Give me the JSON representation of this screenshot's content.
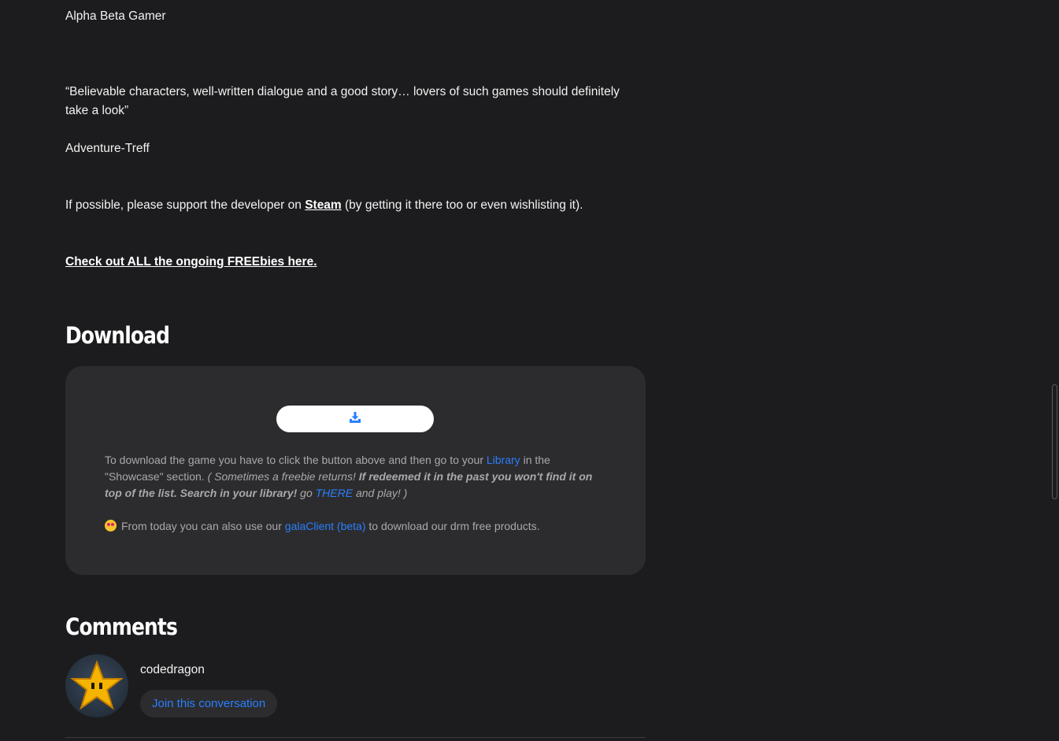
{
  "reviews": {
    "source_1": "Alpha Beta Gamer",
    "quote_2": "“Believable characters, well-written dialogue and a good story… lovers of such games should definitely take a look”",
    "source_2": "Adventure-Treff"
  },
  "support": {
    "prefix": "If possible, please support the developer on ",
    "steam_link": "Steam",
    "suffix": " (by getting it there too or even wishlisting it)."
  },
  "freebies_link": "Check out ALL the ongoing FREEbies here.",
  "download": {
    "heading": "Download",
    "button_icon": "download-icon",
    "text_1": "To download the game you have to click the button above and then go to your ",
    "library_link": "Library",
    "text_2": " in the \"Showcase\" section. ",
    "italic_1": "( Sometimes a freebie returns! ",
    "bold_italic": "If redeemed it in the past you won't find it on top of the list. Search in your library!",
    "italic_2": " go ",
    "there_link": "THERE",
    "italic_3": " and play! )",
    "client_prefix": "From today you can also use our ",
    "client_link": "galaClient (beta)",
    "client_suffix": " to download our drm free products."
  },
  "comments": {
    "heading": "Comments",
    "username": "codedragon",
    "join_button": "Join this conversation"
  },
  "colors": {
    "background": "#1c1c1e",
    "panel": "#2c2c2e",
    "link_blue": "#2a7fff",
    "muted_text": "#a9a9ab"
  }
}
